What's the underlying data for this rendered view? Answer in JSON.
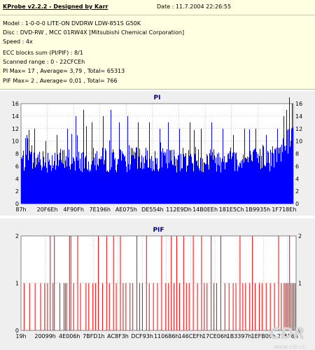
{
  "header": {
    "title": "KProbe v2.2.2 - Designed by Karr",
    "date": "Date : 11.7.2004 22:26:55",
    "model": "Model : 1-0-0-0 LITE-ON DVDRW LDW-851S   G50K",
    "disc": "Disc : DVD-RW , MCC 01RW4X  [Mitsubishi Chemical Corporation]",
    "speed": "Speed : 4x",
    "ecc": "ECC blocks sum (PI/PIF) : 8/1",
    "range": "Scanned range : 0 - 22CFCEh",
    "pi_stats": "PI Max= 17 , Average= 3,79 , Total= 65313",
    "pif_stats": "PIF Max= 2 , Average= 0,01 , Total= 766"
  },
  "colors": {
    "pi": "#0000ff",
    "pif": "#ff0000",
    "grid": "#9a9a9a",
    "plot_bg": "#ffffff",
    "panel_bg": "#efefef",
    "title": "#000080"
  },
  "watermark": {
    "logo": "CDR",
    "url": "www.cdr.cz"
  },
  "chart_data": [
    {
      "type": "bar",
      "title": "PI",
      "xlabel": "",
      "ylabel": "",
      "ylim": [
        0,
        17
      ],
      "yticks": [
        0,
        2,
        4,
        6,
        8,
        10,
        12,
        14,
        16
      ],
      "grid": true,
      "xticks": [
        "87h",
        "20F6Eh",
        "4F90Fh",
        "7E196h",
        "AE075h",
        "DE554h",
        "112E9Dh",
        "14B0EEh",
        "181E5Ch",
        "1B9935h",
        "1F718Eh"
      ],
      "baseline_range": [
        5,
        9
      ],
      "spikes": [
        {
          "pos": 0.02,
          "value": 11
        },
        {
          "pos": 0.05,
          "value": 12
        },
        {
          "pos": 0.09,
          "value": 10
        },
        {
          "pos": 0.13,
          "value": 11
        },
        {
          "pos": 0.17,
          "value": 12
        },
        {
          "pos": 0.2,
          "value": 14
        },
        {
          "pos": 0.23,
          "value": 15
        },
        {
          "pos": 0.26,
          "value": 13
        },
        {
          "pos": 0.3,
          "value": 14
        },
        {
          "pos": 0.33,
          "value": 15
        },
        {
          "pos": 0.36,
          "value": 13
        },
        {
          "pos": 0.39,
          "value": 14
        },
        {
          "pos": 0.43,
          "value": 13
        },
        {
          "pos": 0.47,
          "value": 13
        },
        {
          "pos": 0.51,
          "value": 12
        },
        {
          "pos": 0.54,
          "value": 13
        },
        {
          "pos": 0.58,
          "value": 12
        },
        {
          "pos": 0.62,
          "value": 13
        },
        {
          "pos": 0.66,
          "value": 12
        },
        {
          "pos": 0.7,
          "value": 13
        },
        {
          "pos": 0.74,
          "value": 12
        },
        {
          "pos": 0.78,
          "value": 11
        },
        {
          "pos": 0.82,
          "value": 12
        },
        {
          "pos": 0.86,
          "value": 12
        },
        {
          "pos": 0.9,
          "value": 11
        },
        {
          "pos": 0.94,
          "value": 12
        },
        {
          "pos": 0.965,
          "value": 14
        },
        {
          "pos": 0.975,
          "value": 15
        },
        {
          "pos": 0.985,
          "value": 17
        },
        {
          "pos": 0.995,
          "value": 16
        }
      ]
    },
    {
      "type": "bar",
      "title": "PIF",
      "xlabel": "",
      "ylabel": "",
      "ylim": [
        0,
        2
      ],
      "yticks": [
        0,
        1,
        2
      ],
      "grid": true,
      "xticks": [
        "19h",
        "20099h",
        "4E006h",
        "7BFD1h",
        "AC8F3h",
        "DCF93h",
        "110686h",
        "146CEFh",
        "17CE06h",
        "1B3397h",
        "1EFB09h",
        "225F6h"
      ],
      "value_two_positions": [
        0.105,
        0.12,
        0.175,
        0.18,
        0.205,
        0.28,
        0.31,
        0.335,
        0.36,
        0.42,
        0.455,
        0.51,
        0.545,
        0.565,
        0.59,
        0.625,
        0.655,
        0.69,
        0.725,
        0.795,
        0.84,
        0.935,
        0.975
      ],
      "value_one_positions": [
        0.01,
        0.03,
        0.05,
        0.07,
        0.085,
        0.095,
        0.115,
        0.14,
        0.155,
        0.16,
        0.165,
        0.19,
        0.215,
        0.235,
        0.245,
        0.26,
        0.27,
        0.295,
        0.32,
        0.345,
        0.37,
        0.38,
        0.395,
        0.405,
        0.43,
        0.44,
        0.465,
        0.48,
        0.495,
        0.525,
        0.535,
        0.555,
        0.575,
        0.6,
        0.61,
        0.64,
        0.665,
        0.675,
        0.7,
        0.71,
        0.74,
        0.755,
        0.77,
        0.78,
        0.805,
        0.815,
        0.83,
        0.85,
        0.865,
        0.875,
        0.89,
        0.905,
        0.92,
        0.945,
        0.955,
        0.96,
        0.965,
        0.97,
        0.98,
        0.985,
        0.99,
        0.995
      ]
    }
  ]
}
